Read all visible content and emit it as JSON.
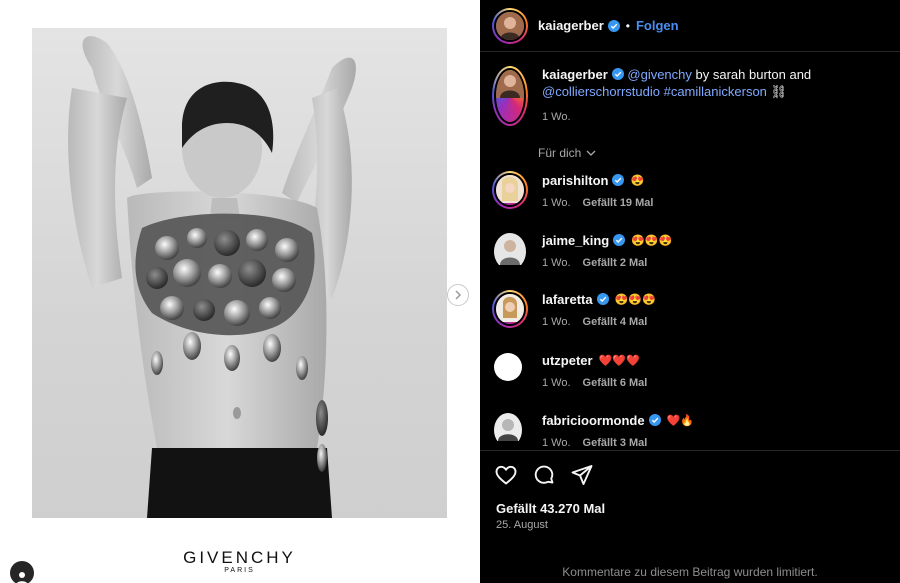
{
  "post": {
    "brand_name": "GIVENCHY",
    "brand_city": "PARIS",
    "next_icon": "chevron-right-icon",
    "tagged_icon": "user-icon"
  },
  "header": {
    "username": "kaiagerber",
    "separator": "•",
    "follow_label": "Folgen"
  },
  "caption": {
    "username": "kaiagerber",
    "mention1": "@givenchy",
    "text1": " by sarah burton and ",
    "mention2": "@collierschorrstudio",
    "hashtag": "#camillanickerson",
    "emoji": "⛓",
    "time": "1 Wo."
  },
  "filter_label": "Für dich",
  "comments": [
    {
      "username": "parishilton",
      "verified": true,
      "text": "😍",
      "time": "1 Wo.",
      "likes": "Gefällt 19 Mal"
    },
    {
      "username": "jaime_king",
      "verified": true,
      "text": "😍😍😍",
      "time": "1 Wo.",
      "likes": "Gefällt 2 Mal"
    },
    {
      "username": "lafaretta",
      "verified": true,
      "text": "😍😍😍",
      "time": "1 Wo.",
      "likes": "Gefällt 4 Mal"
    },
    {
      "username": "utzpeter",
      "verified": false,
      "text": "❤️❤️❤️",
      "time": "1 Wo.",
      "likes": "Gefällt 6 Mal"
    },
    {
      "username": "fabricioormonde",
      "verified": true,
      "text": "❤️🔥",
      "time": "1 Wo.",
      "likes": "Gefällt 3 Mal"
    }
  ],
  "actions": {
    "like_icon": "heart-icon",
    "comment_icon": "comment-icon",
    "share_icon": "send-icon"
  },
  "likes_total": "Gefällt 43.270 Mal",
  "post_date": "25. August",
  "comments_limited": "Kommentare zu diesem Beitrag wurden limitiert.",
  "colors": {
    "panel_bg": "#000000",
    "link": "#7fa9ff",
    "follow": "#4a8ff0",
    "verified": "#3897f0",
    "muted": "#a8a8a8"
  }
}
